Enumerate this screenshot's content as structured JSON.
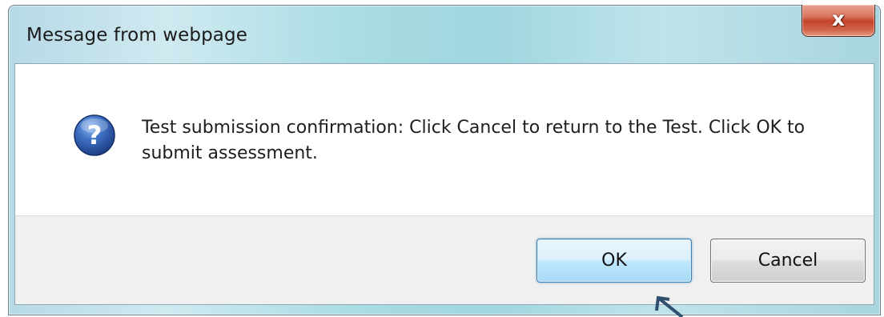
{
  "window": {
    "title": "Message from webpage",
    "close_icon": "close-x-icon",
    "close_glyph": "x"
  },
  "message": {
    "icon": "question-mark-icon",
    "text": "Test submission confirmation: Click Cancel to return to the Test. Click OK to submit assessment."
  },
  "buttons": {
    "ok_label": "OK",
    "cancel_label": "Cancel"
  },
  "colors": {
    "titlebar": "#a9dce4",
    "close_button": "#c4432a",
    "ok_border": "#3c7fb1",
    "question_icon": "#2e5fa8"
  }
}
